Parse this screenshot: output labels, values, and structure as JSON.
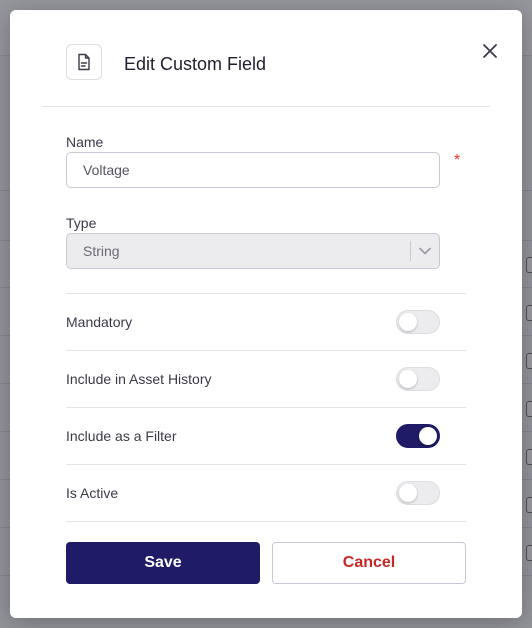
{
  "modal": {
    "title": "Edit Custom Field",
    "close_icon": "close-icon",
    "header_icon": "document-icon"
  },
  "form": {
    "name": {
      "label": "Name",
      "value": "Voltage",
      "required_mark": "*"
    },
    "type": {
      "label": "Type",
      "selected": "String"
    },
    "toggles": [
      {
        "label": "Mandatory",
        "on": false
      },
      {
        "label": "Include in Asset History",
        "on": false
      },
      {
        "label": "Include as a Filter",
        "on": true
      },
      {
        "label": "Is Active",
        "on": false
      }
    ]
  },
  "actions": {
    "save_label": "Save",
    "cancel_label": "Cancel"
  },
  "colors": {
    "primary": "#1f1b66",
    "danger": "#c62828",
    "required": "#e53935"
  }
}
